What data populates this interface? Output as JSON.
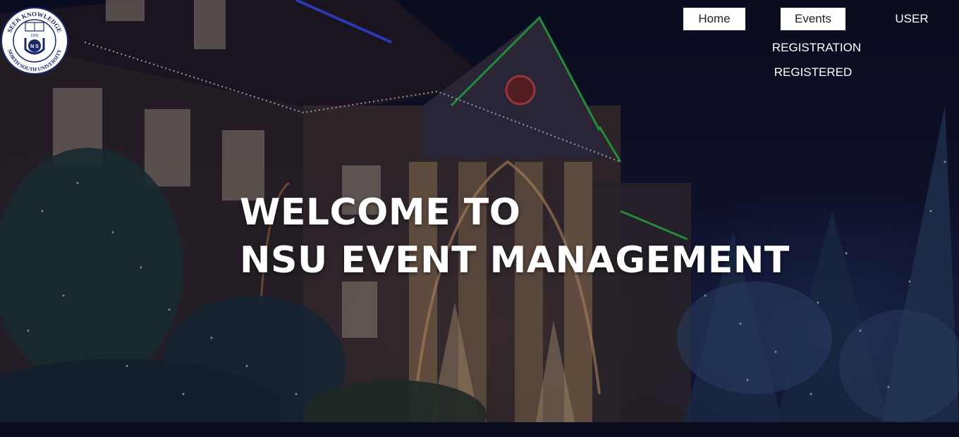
{
  "logo": {
    "alt": "North South University seal",
    "top_text": "SEEK KNOWLEDGE",
    "bottom_text": "NORTH SOUTH UNIVERSITY",
    "year": "1992",
    "center_letters": "N S"
  },
  "nav": {
    "home": "Home",
    "events": "Events",
    "user": "USER",
    "registration": "REGISTRATION",
    "registered": "REGISTERED"
  },
  "hero": {
    "line1": "WELCOME TO",
    "line2": "NSU EVENT MANAGEMENT"
  },
  "colors": {
    "nav_button_bg": "#ffffff",
    "nav_button_text": "#222222",
    "text_light": "#ffffff",
    "night_sky": "#0b0e22"
  }
}
